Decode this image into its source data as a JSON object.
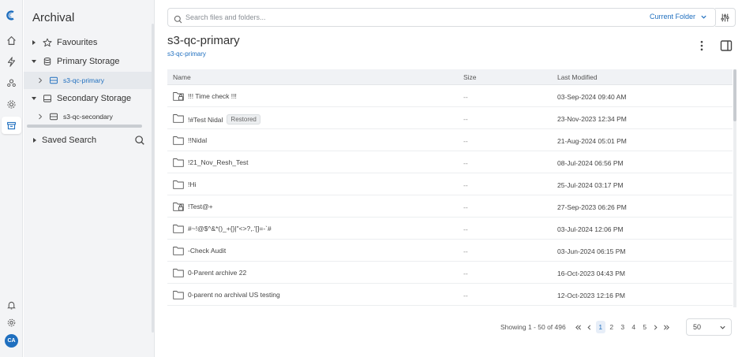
{
  "rail": {
    "items": [
      {
        "icon": "home-icon"
      },
      {
        "icon": "lightning-icon"
      },
      {
        "icon": "users-icon"
      },
      {
        "icon": "gear-icon"
      },
      {
        "icon": "archive-icon",
        "active": true
      }
    ],
    "bottom": [
      {
        "icon": "bell-icon"
      },
      {
        "icon": "settings-icon"
      }
    ],
    "avatar_initials": "CA"
  },
  "panel": {
    "title": "Archival",
    "tree": [
      {
        "label": "Favourites",
        "icon": "star-icon",
        "caret": "right",
        "level": 0
      },
      {
        "label": "Primary Storage",
        "icon": "database-icon",
        "caret": "down",
        "level": 0
      },
      {
        "label": "s3-qc-primary",
        "icon": "drive-icon",
        "caret": "right",
        "level": 1,
        "selected": true
      },
      {
        "label": "Secondary Storage",
        "icon": "storage-icon",
        "caret": "down",
        "level": 0
      },
      {
        "label": "s3-qc-secondary",
        "icon": "drive-icon",
        "caret": "right",
        "level": 1
      }
    ],
    "saved_search": "Saved Search"
  },
  "search": {
    "placeholder": "Search files and folders...",
    "scope": "Current Folder"
  },
  "main": {
    "title": "s3-qc-primary",
    "breadcrumb": "s3-qc-primary"
  },
  "table": {
    "columns": {
      "name": "Name",
      "size": "Size",
      "modified": "Last Modified"
    },
    "rows": [
      {
        "name": "!!! Time check !!!",
        "size": "--",
        "modified": "03-Sep-2024 09:40 AM",
        "locked": true
      },
      {
        "name": "!#Test Nidal",
        "badge": "Restored",
        "size": "--",
        "modified": "23-Nov-2023 12:34 PM"
      },
      {
        "name": "!!Nidal",
        "size": "--",
        "modified": "21-Aug-2024 05:01 PM"
      },
      {
        "name": "!21_Nov_Resh_Test",
        "size": "--",
        "modified": "08-Jul-2024 06:56 PM"
      },
      {
        "name": "!Hi",
        "size": "--",
        "modified": "25-Jul-2024 03:17 PM"
      },
      {
        "name": "!Test@+",
        "size": "--",
        "modified": "27-Sep-2023 06:26 PM",
        "locked": true
      },
      {
        "name": "#~!@$^&*()_+{}|\"<>?,.'[]=-`#",
        "size": "--",
        "modified": "03-Jul-2024 12:06 PM"
      },
      {
        "name": "-Check Audit",
        "size": "--",
        "modified": "03-Jun-2024 06:15 PM"
      },
      {
        "name": "0-Parent archive 22",
        "size": "--",
        "modified": "16-Oct-2023 04:43 PM"
      },
      {
        "name": "0-parent no archival US testing",
        "size": "--",
        "modified": "12-Oct-2023 12:16 PM"
      }
    ]
  },
  "pagination": {
    "info": "Showing 1 - 50 of 496",
    "pages": [
      "1",
      "2",
      "3",
      "4",
      "5"
    ],
    "current": "1",
    "per_page": "50"
  },
  "colors": {
    "accent": "#1f6fbf",
    "rail_bg": "#f3f4f6",
    "header_bg": "#f0f2f5"
  }
}
